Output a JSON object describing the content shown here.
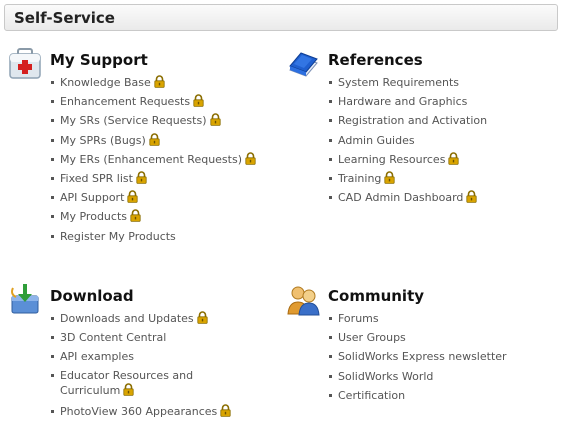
{
  "header": {
    "title": "Self-Service"
  },
  "sections": {
    "my_support": {
      "title": "My Support",
      "icon": "first-aid-kit-icon",
      "items": [
        {
          "label": "Knowledge Base",
          "locked": true
        },
        {
          "label": "Enhancement Requests",
          "locked": true
        },
        {
          "label": "My SRs (Service Requests)",
          "locked": true
        },
        {
          "label": "My SPRs (Bugs)",
          "locked": true
        },
        {
          "label": "My ERs (Enhancement Requests)",
          "locked": true
        },
        {
          "label": "Fixed SPR list",
          "locked": true
        },
        {
          "label": "API Support",
          "locked": true
        },
        {
          "label": "My Products",
          "locked": true
        },
        {
          "label": "Register My Products",
          "locked": false
        }
      ]
    },
    "references": {
      "title": "References",
      "icon": "blue-book-icon",
      "items": [
        {
          "label": "System Requirements",
          "locked": false
        },
        {
          "label": "Hardware and Graphics",
          "locked": false
        },
        {
          "label": "Registration and Activation",
          "locked": false
        },
        {
          "label": "Admin Guides",
          "locked": false
        },
        {
          "label": "Learning Resources",
          "locked": true
        },
        {
          "label": "Training",
          "locked": true
        },
        {
          "label": "CAD Admin Dashboard",
          "locked": true
        }
      ]
    },
    "download": {
      "title": "Download",
      "icon": "download-box-icon",
      "items": [
        {
          "label": "Downloads and Updates",
          "locked": true
        },
        {
          "label": "3D Content Central",
          "locked": false
        },
        {
          "label": "API examples",
          "locked": false
        },
        {
          "label": "Educator Resources and Curriculum",
          "locked": true
        },
        {
          "label": "PhotoView 360 Appearances",
          "locked": true
        }
      ]
    },
    "community": {
      "title": "Community",
      "icon": "people-icon",
      "items": [
        {
          "label": "Forums",
          "locked": false
        },
        {
          "label": "User Groups",
          "locked": false
        },
        {
          "label": "SolidWorks Express newsletter",
          "locked": false
        },
        {
          "label": "SolidWorks World",
          "locked": false
        },
        {
          "label": "Certification",
          "locked": false
        }
      ]
    }
  },
  "colors": {
    "lock": "#d9a400",
    "link": "#555555",
    "header_border": "#c9c9c9"
  }
}
